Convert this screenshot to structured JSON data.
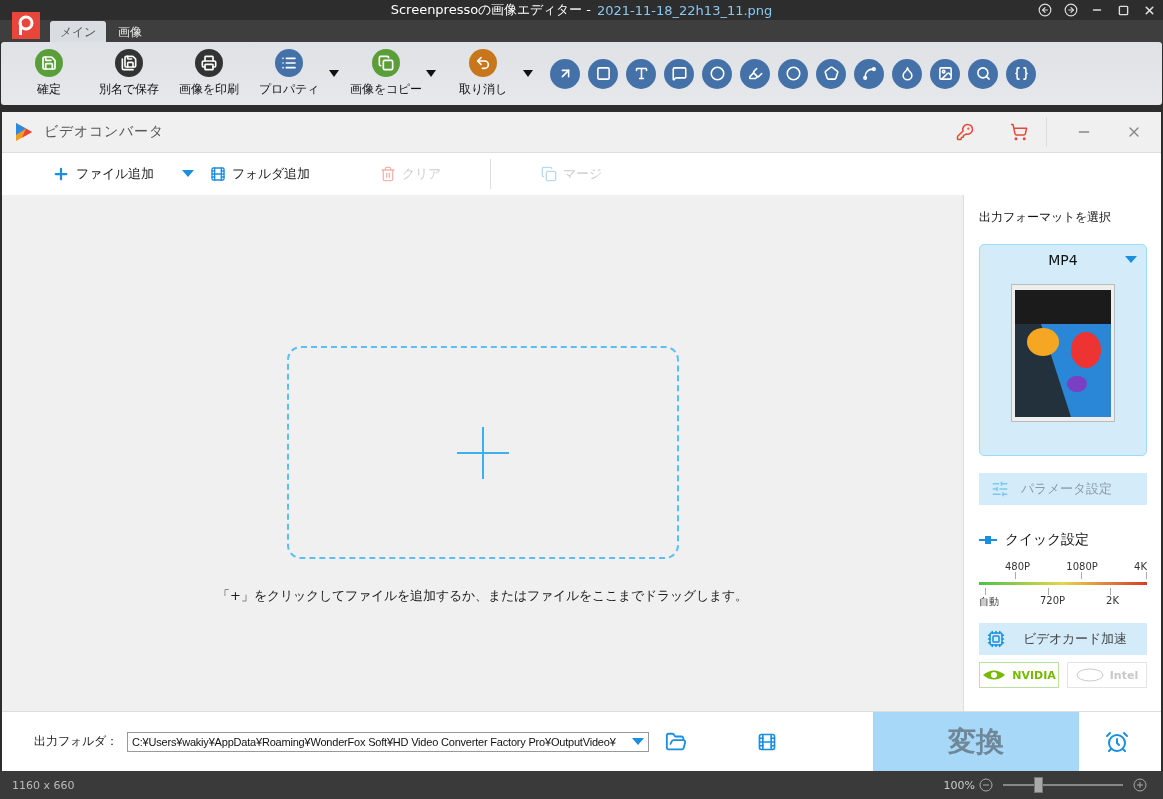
{
  "window": {
    "title": "Screenpressoの画像エディター",
    "separator": "-",
    "file": "2021-11-18_22h13_11.png"
  },
  "ribbon_tabs": [
    {
      "label": "メイン",
      "selected": true
    },
    {
      "label": "画像",
      "selected": false
    }
  ],
  "ribbon_buttons": [
    {
      "label": "確定",
      "kind": "save",
      "color": "#5a9e3a",
      "dropdown": false
    },
    {
      "label": "別名で保存",
      "kind": "saveas",
      "color": "#333333",
      "dropdown": false
    },
    {
      "label": "画像を印刷",
      "kind": "print",
      "color": "#333333",
      "dropdown": false
    },
    {
      "label": "プロパティ",
      "kind": "properties",
      "color": "#4472a8",
      "dropdown": true
    },
    {
      "label": "画像をコピー",
      "kind": "copy",
      "color": "#5a9e3a",
      "dropdown": true
    },
    {
      "label": "取り消し",
      "kind": "undo",
      "color": "#c8761c",
      "dropdown": true
    }
  ],
  "tools": [
    {
      "kind": "arrow"
    },
    {
      "kind": "rectangle"
    },
    {
      "kind": "text"
    },
    {
      "kind": "callout"
    },
    {
      "kind": "counter"
    },
    {
      "kind": "highlighter"
    },
    {
      "kind": "ellipse"
    },
    {
      "kind": "polygon"
    },
    {
      "kind": "freehand"
    },
    {
      "kind": "blur"
    },
    {
      "kind": "image"
    },
    {
      "kind": "magnifier"
    },
    {
      "kind": "brace"
    }
  ],
  "converter": {
    "title": "ビデオコンバータ",
    "toolbar": [
      {
        "kind": "add",
        "label": "ファイル追加",
        "disabled": false
      },
      {
        "kind": "menu",
        "disabled": false
      },
      {
        "kind": "folder",
        "label": "フォルダ追加",
        "disabled": false
      },
      {
        "kind": "clear",
        "label": "クリア",
        "disabled": true
      },
      {
        "kind": "merge",
        "label": "マージ",
        "disabled": true
      }
    ],
    "drop_hint": "「+」をクリックしてファイルを追加するか、またはファイルをここまでドラッグします。",
    "panel": {
      "heading": "出力フォーマットを選択",
      "format": "MP4",
      "parameter_button": {
        "label": "パラメータ設定",
        "disabled": true
      },
      "quick_settings": "クイック設定",
      "scale_top": [
        "480P",
        "1080P",
        "4K"
      ],
      "scale_bottom": [
        "自動",
        "720P",
        "2K"
      ],
      "gpu_button": "ビデオカード加速",
      "vendors": [
        {
          "kind": "nvidia",
          "label": "NVIDIA",
          "selected": true
        },
        {
          "kind": "intel",
          "label": "Intel",
          "selected": false
        }
      ]
    },
    "output_label": "出力フォルダ：",
    "output_path": "C:¥Users¥wakiy¥AppData¥Roaming¥WonderFox Soft¥HD Video Converter Factory Pro¥OutputVideo¥",
    "convert_button": {
      "label": "変換",
      "disabled": true
    }
  },
  "status_bar": {
    "size": "1160 x 660",
    "zoom": "100%",
    "level": 0.29
  }
}
